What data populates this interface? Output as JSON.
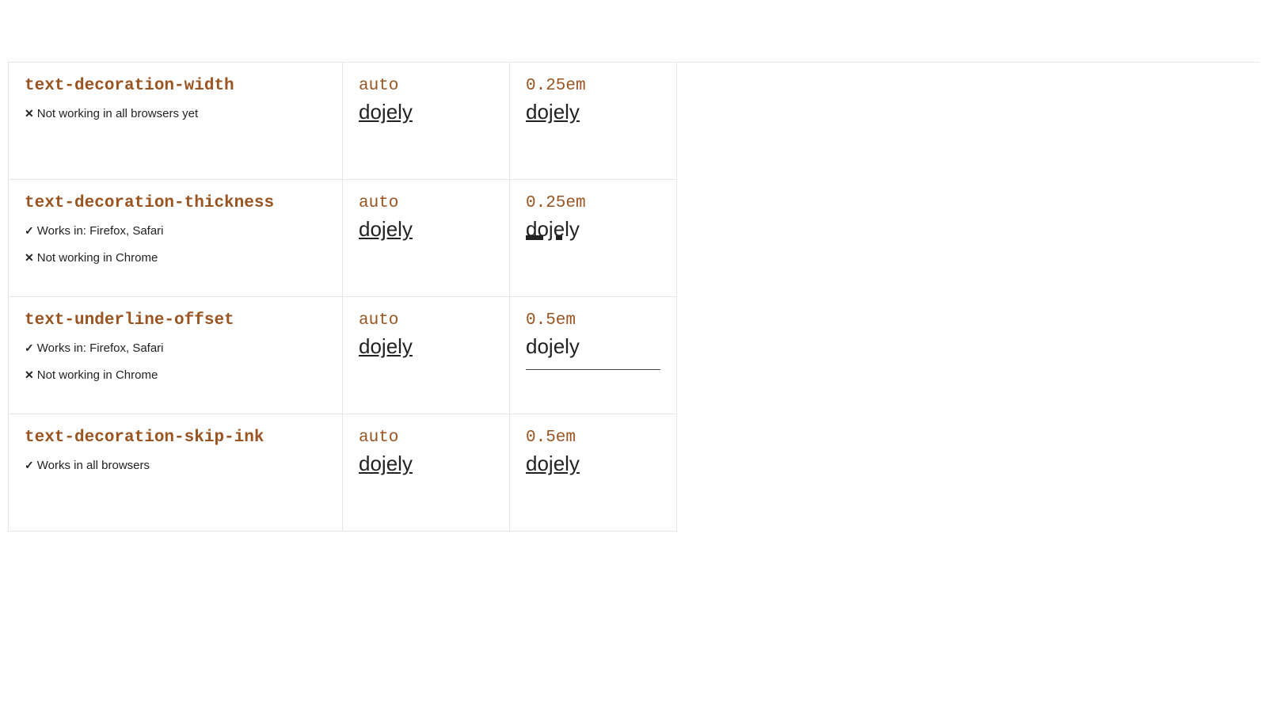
{
  "sample_text": "dojely",
  "rows": [
    {
      "property": "text-decoration-width",
      "notes": [
        {
          "icon": "✕",
          "text": "Not working in all browsers yet"
        }
      ],
      "col_a_label": "auto",
      "col_b_label": "0.25em",
      "col_b_variant": ""
    },
    {
      "property": "text-decoration-thickness",
      "notes": [
        {
          "icon": "✓",
          "text": "Works in: Firefox, Safari"
        },
        {
          "icon": "✕",
          "text": "Not working in Chrome"
        }
      ],
      "col_a_label": "auto",
      "col_b_label": "0.25em",
      "col_b_variant": "thick-broken"
    },
    {
      "property": "text-underline-offset",
      "notes": [
        {
          "icon": "✓",
          "text": "Works in: Firefox, Safari"
        },
        {
          "icon": "✕",
          "text": "Not working in Chrome"
        }
      ],
      "col_a_label": "auto",
      "col_b_label": "0.5em",
      "col_b_variant": "offset"
    },
    {
      "property": "text-decoration-skip-ink",
      "notes": [
        {
          "icon": "✓",
          "text": "Works in all browsers"
        }
      ],
      "col_a_label": "auto",
      "col_b_label": "0.5em",
      "col_b_variant": ""
    }
  ]
}
